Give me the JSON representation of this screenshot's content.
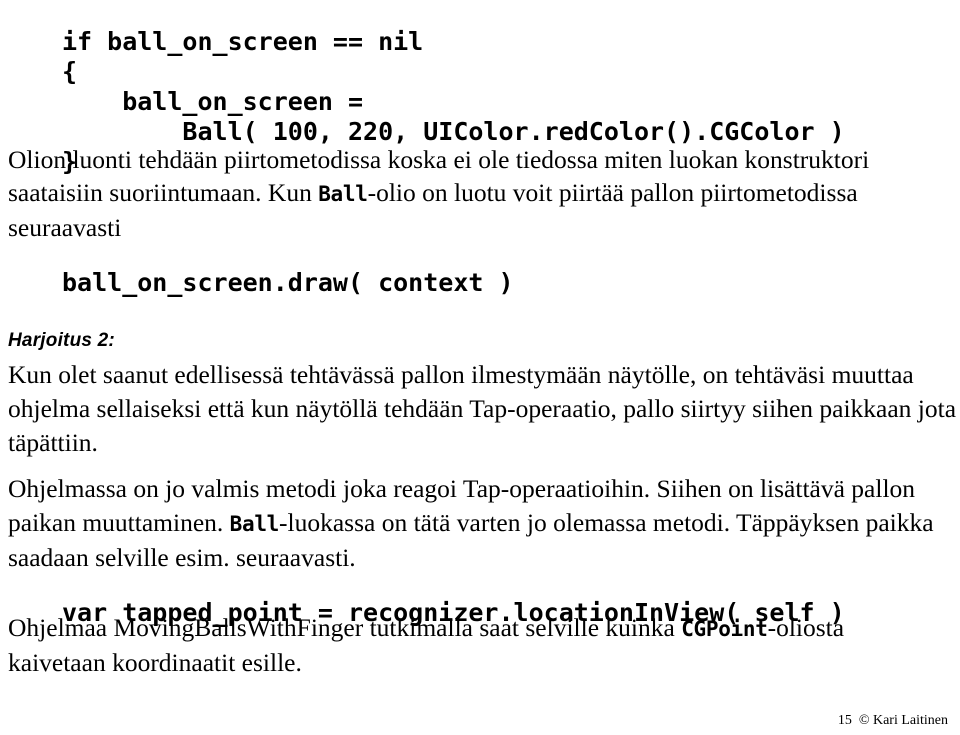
{
  "page": {
    "language": "fi",
    "background_color": "#ffffff",
    "text_color": "#000000"
  },
  "code_main": {
    "lines": [
      "if ball_on_screen == nil",
      "{",
      "    ball_on_screen =",
      "        Ball( 100, 220, UIColor.redColor().CGColor )",
      "}"
    ],
    "full_text": "if ball_on_screen == nil\n{\n    ball_on_screen =\n        Ball( 100, 220, UIColor.redColor().CGColor )\n}"
  },
  "para_olion": {
    "part1": "Olion luonti tehdään piirtometodissa koska ei ole tiedossa miten luokan konstruktori saataisiin suoriintumaan. Kun ",
    "mono1": "Ball",
    "part2": "-olio on luotu voit piirtää pallon piirtometodissa seuraavasti"
  },
  "code_draw": {
    "lines": [
      "ball_on_screen.draw( context )"
    ],
    "full_text": "ball_on_screen.draw( context )"
  },
  "heading_harjoitus": {
    "label": "Harjoitus 2:"
  },
  "para_kun": {
    "text": "Kun olet saanut edellisessä tehtävässä pallon ilmestymään näytölle, on tehtäväsi muuttaa ohjelma sellaiseksi että kun näytöllä tehdään Tap-operaatio, pallo siirtyy siihen paikkaan jota täpättiin."
  },
  "para_ohjelmassa": {
    "part1": "Ohjelmassa on jo valmis metodi joka reagoi Tap-operaatioihin. Siihen on lisättävä pallon paikan muuttaminen. ",
    "mono1": "Ball",
    "part2": "-luokassa on tätä varten jo olemassa metodi. Täppäyksen paikka saadaan selville esim. seuraavasti."
  },
  "code_tapped": {
    "lines": [
      "var tapped_point = recognizer.locationInView( self )"
    ],
    "full_text": "var tapped_point = recognizer.locationInView( self )"
  },
  "para_ohjelmaa": {
    "part1": "Ohjelmaa MovingBallsWithFinger tutkimalla saat selville kuinka ",
    "mono1": "CGPoint",
    "part2": "-oliosta kaivetaan koordinaatit esille."
  },
  "footer": {
    "page_number": "15",
    "copyright": "© Kari Laitinen",
    "text": "15  © Kari Laitinen"
  }
}
